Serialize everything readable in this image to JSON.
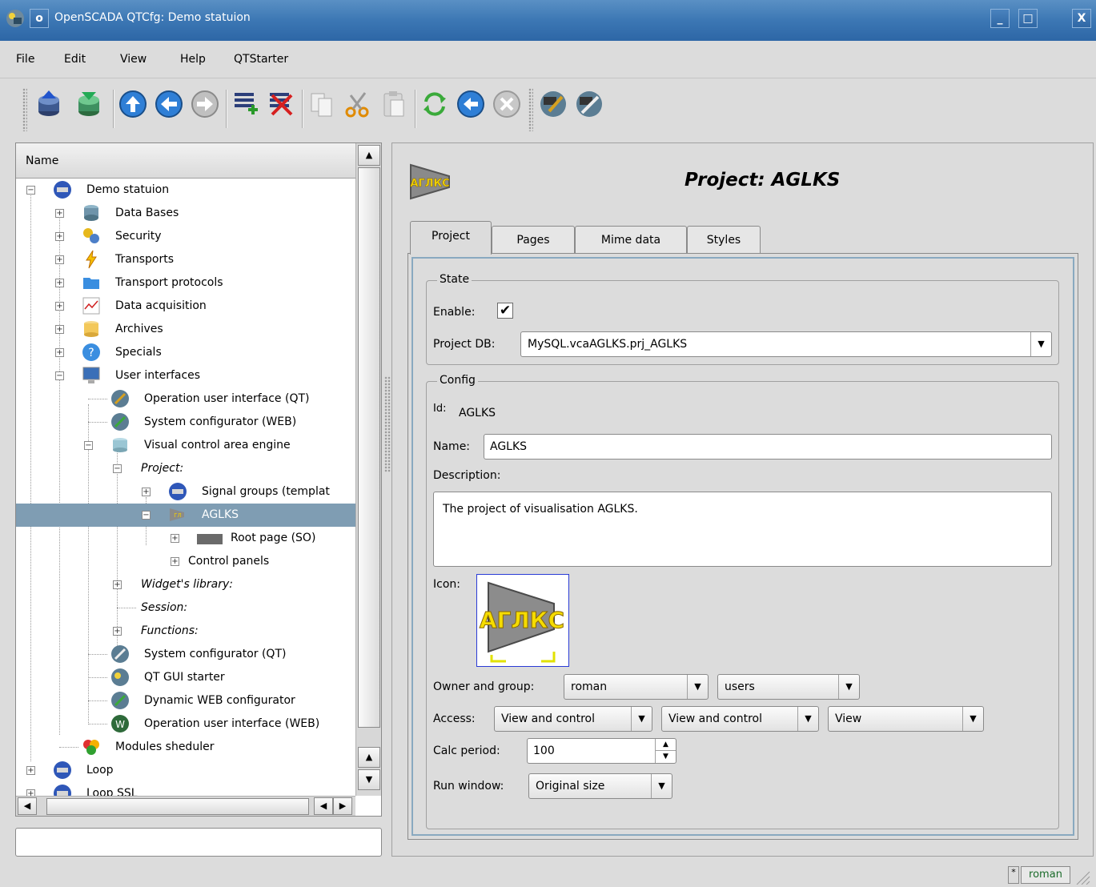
{
  "window": {
    "title": "OpenSCADA QTCfg: Demo statuion",
    "minimize": "_",
    "maximize": "□",
    "close": "X"
  },
  "menu": [
    {
      "label": "File"
    },
    {
      "label": "Edit"
    },
    {
      "label": "View"
    },
    {
      "label": "Help"
    },
    {
      "label": "QTStarter"
    }
  ],
  "toolbar": {
    "icons": [
      "db-load-icon",
      "db-save-icon",
      "up-icon",
      "back-icon",
      "forward-icon",
      "add-item-icon",
      "delete-item-icon",
      "copy-icon",
      "cut-icon",
      "paste-icon",
      "refresh-icon",
      "start-icon",
      "stop-icon",
      "vision-runtime-icon",
      "configurator-icon"
    ]
  },
  "tree": {
    "header": "Name",
    "items": [
      {
        "label": "Demo statuion",
        "italic": false
      },
      {
        "label": "Data Bases",
        "italic": false
      },
      {
        "label": "Security",
        "italic": false
      },
      {
        "label": "Transports",
        "italic": false
      },
      {
        "label": "Transport protocols",
        "italic": false
      },
      {
        "label": "Data acquisition",
        "italic": false
      },
      {
        "label": "Archives",
        "italic": false
      },
      {
        "label": "Specials",
        "italic": false
      },
      {
        "label": "User interfaces",
        "italic": false
      },
      {
        "label": "Operation user interface (QT)",
        "italic": false
      },
      {
        "label": "System configurator (WEB)",
        "italic": false
      },
      {
        "label": "Visual control area engine",
        "italic": false
      },
      {
        "label": "Project:",
        "italic": true
      },
      {
        "label": "Signal groups (templat",
        "italic": false
      },
      {
        "label": "AGLKS",
        "italic": false
      },
      {
        "label": "Root page (SO)",
        "italic": false
      },
      {
        "label": "Control panels",
        "italic": false
      },
      {
        "label": "Widget's library:",
        "italic": true
      },
      {
        "label": "Session:",
        "italic": true
      },
      {
        "label": "Functions:",
        "italic": true
      },
      {
        "label": "System configurator (QT)",
        "italic": false
      },
      {
        "label": "QT GUI starter",
        "italic": false
      },
      {
        "label": "Dynamic WEB configurator",
        "italic": false
      },
      {
        "label": "Operation user interface (WEB)",
        "italic": false
      },
      {
        "label": "Modules sheduler",
        "italic": false
      },
      {
        "label": "Loop",
        "italic": false
      },
      {
        "label": "Loop SSL",
        "italic": false
      }
    ]
  },
  "panel": {
    "title": "Project: AGLKS",
    "logo_text": "АГЛКС",
    "tabs": [
      "Project",
      "Pages",
      "Mime data",
      "Styles"
    ],
    "state": {
      "group": "State",
      "enable_label": "Enable:",
      "enable_checked": true,
      "db_label": "Project DB:",
      "db_value": "MySQL.vcaAGLKS.prj_AGLKS"
    },
    "config": {
      "group": "Config",
      "id_label": "Id:",
      "id_value": "AGLKS",
      "name_label": "Name:",
      "name_value": "AGLKS",
      "desc_label": "Description:",
      "desc_value": "The project of visualisation AGLKS.",
      "icon_label": "Icon:",
      "icon_text": "АГЛКС",
      "owner_label": "Owner and group:",
      "owner_value": "roman",
      "group_value": "users",
      "access_label": "Access:",
      "access_user": "View and control",
      "access_group": "View and control",
      "access_other": "View",
      "calc_label": "Calc period:",
      "calc_value": "100",
      "run_label": "Run window:",
      "run_value": "Original size"
    }
  },
  "statusbar": {
    "star": "*",
    "user": "roman"
  },
  "colors": {
    "titlebar": "#3c77b4",
    "selection": "#7f9db3",
    "tab_frame": "#89a9c0"
  }
}
